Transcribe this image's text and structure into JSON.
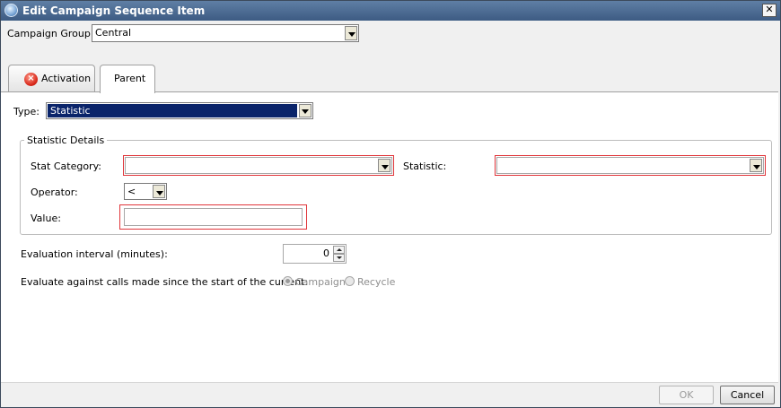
{
  "window": {
    "title": "Edit Campaign Sequence Item",
    "close_label": "✕"
  },
  "campaign_group": {
    "label": "Campaign Group:",
    "value": "Central"
  },
  "tabs": [
    {
      "label": "Activation",
      "has_error": true
    },
    {
      "label": "Parent",
      "selected": true
    }
  ],
  "type": {
    "label": "Type:",
    "value": "Statistic"
  },
  "statistic_details": {
    "legend": "Statistic Details",
    "stat_category": {
      "label": "Stat Category:",
      "value": ""
    },
    "statistic": {
      "label": "Statistic:",
      "value": ""
    },
    "operator": {
      "label": "Operator:",
      "value": "<"
    },
    "value": {
      "label": "Value:",
      "value": ""
    }
  },
  "evaluation_interval": {
    "label": "Evaluation interval (minutes):",
    "value": "0"
  },
  "evaluate_against": {
    "label": "Evaluate against calls made since the start of the current:",
    "options": [
      {
        "label": "Campaign",
        "selected": true
      },
      {
        "label": "Recycle",
        "selected": false
      }
    ]
  },
  "buttons": {
    "ok": "OK",
    "cancel": "Cancel"
  },
  "colors": {
    "validation_border": "#e0353a",
    "selection_bg": "#0a246a",
    "titlebar": "#4a6a93"
  }
}
